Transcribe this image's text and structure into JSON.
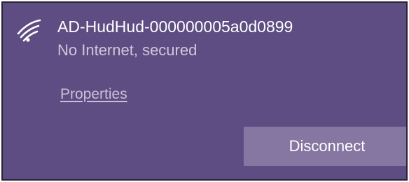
{
  "network": {
    "ssid": "AD-HudHud-000000005a0d0899",
    "status": "No Internet, secured",
    "icon": "wifi-signal-icon"
  },
  "actions": {
    "properties_label": "Properties",
    "disconnect_label": "Disconnect"
  },
  "colors": {
    "panel_background": "#5e4d82",
    "button_background": "#8677a2",
    "primary_text": "#ffffff",
    "secondary_text": "#cfc7dd"
  }
}
